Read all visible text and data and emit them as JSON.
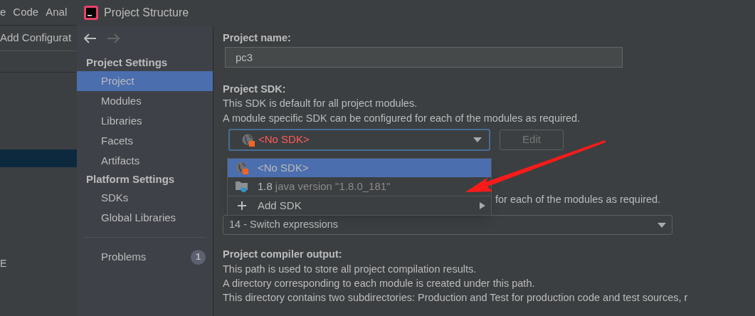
{
  "background_ide": {
    "menu": [
      "e",
      "Code",
      "Anal"
    ],
    "toolbar_text": "Add Configurat",
    "side_text": "E"
  },
  "window": {
    "title": "Project Structure"
  },
  "sidebar": {
    "groups": [
      {
        "title": "Project Settings",
        "items": [
          {
            "label": "Project",
            "selected": true
          },
          {
            "label": "Modules",
            "selected": false
          },
          {
            "label": "Libraries",
            "selected": false
          },
          {
            "label": "Facets",
            "selected": false
          },
          {
            "label": "Artifacts",
            "selected": false
          }
        ]
      },
      {
        "title": "Platform Settings",
        "items": [
          {
            "label": "SDKs",
            "selected": false
          },
          {
            "label": "Global Libraries",
            "selected": false
          }
        ]
      }
    ],
    "problems": {
      "label": "Problems",
      "count": "1"
    }
  },
  "project_name": {
    "label": "Project name:",
    "value": "pc3"
  },
  "project_sdk": {
    "label": "Project SDK:",
    "lines": [
      "This SDK is default for all project modules.",
      "A module specific SDK can be configured for each of the modules as required."
    ],
    "value": "<No SDK>",
    "edit_button": {
      "label": "Edit",
      "disabled": true
    },
    "popup": [
      {
        "kind": "sdk",
        "label": "<No SDK>",
        "selected": true
      },
      {
        "kind": "jdk",
        "label": "1.8",
        "detail": "java version \"1.8.0_181\"",
        "selected": false
      },
      {
        "kind": "add",
        "label": "Add SDK",
        "selected": false
      }
    ]
  },
  "language_level": {
    "line_tail": "for each of the modules as required.",
    "value": "14 - Switch expressions"
  },
  "compiler_output": {
    "label": "Project compiler output:",
    "lines": [
      "This path is used to store all project compilation results.",
      "A directory corresponding to each module is created under this path.",
      "This directory contains two subdirectories: Production and Test for production code and test sources, r"
    ]
  }
}
